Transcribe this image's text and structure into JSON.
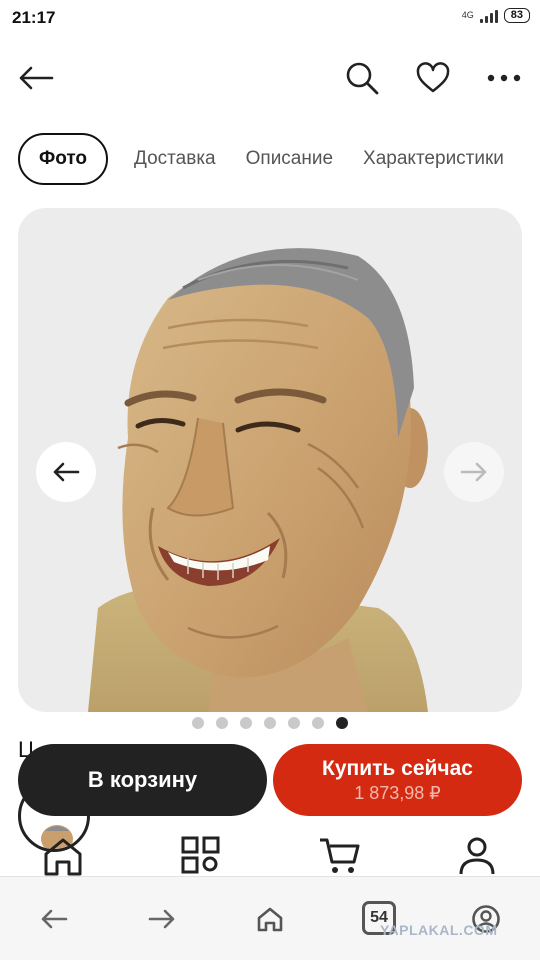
{
  "status_bar": {
    "time": "21:17",
    "network": "4G",
    "battery": "83"
  },
  "header": {
    "back_icon": "arrow-left-icon",
    "search_icon": "search-icon",
    "favorite_icon": "heart-icon",
    "more_icon": "more-dots-icon"
  },
  "tabs": [
    {
      "label": "Фото",
      "active": true
    },
    {
      "label": "Доставка",
      "active": false
    },
    {
      "label": "Описание",
      "active": false
    },
    {
      "label": "Характеристики",
      "active": false
    }
  ],
  "gallery": {
    "image_subject": "latex mask of a smiling grey-haired man",
    "prev_icon": "arrow-left-icon",
    "next_icon": "arrow-right-icon",
    "dots_total": 7,
    "active_dot": 7
  },
  "seller": {
    "peek_text": "Ц"
  },
  "actions": {
    "cart_label": "В корзину",
    "buy_label": "Купить сейчас",
    "buy_price": "1 873,98 ₽"
  },
  "app_nav": {
    "items": [
      "home-icon",
      "catalog-icon",
      "cart-icon",
      "profile-icon"
    ]
  },
  "browser_bar": {
    "tabs_count": "54",
    "watermark": "YAPLAKAL.COM"
  },
  "colors": {
    "buy_accent": "#d32a11",
    "cart_dark": "#222222"
  }
}
